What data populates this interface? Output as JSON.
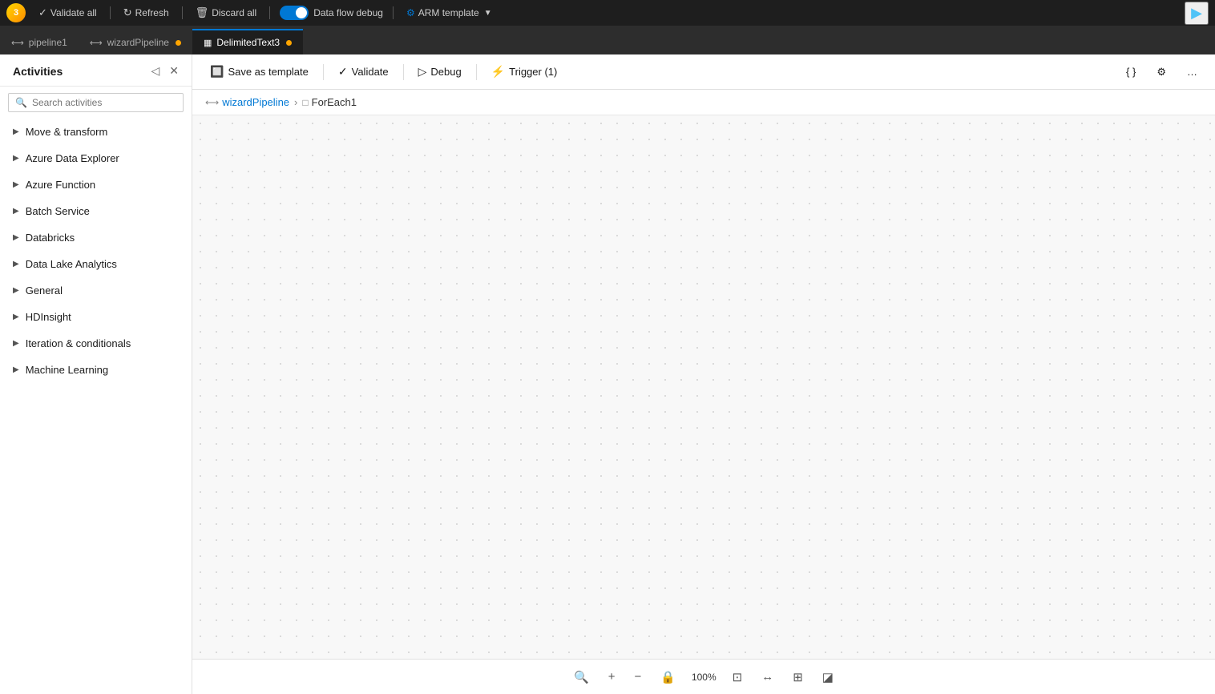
{
  "app": {
    "icon_label": "3",
    "validate_all_label": "Validate all",
    "refresh_label": "Refresh",
    "discard_all_label": "Discard all",
    "data_flow_debug_label": "Data flow debug",
    "arm_template_label": "ARM template",
    "run_icon": "▶"
  },
  "tabs": [
    {
      "id": "pipeline1",
      "label": "pipeline1",
      "icon": "🔀",
      "active": false,
      "dirty": false
    },
    {
      "id": "wizardPipeline",
      "label": "wizardPipeline",
      "icon": "🔀",
      "active": false,
      "dirty": true
    },
    {
      "id": "DelimitedText3",
      "label": "DelimitedText3",
      "icon": "📋",
      "active": true,
      "dirty": true
    }
  ],
  "sidebar": {
    "title": "Activities",
    "search_placeholder": "Search activities",
    "items": [
      {
        "id": "move-transform",
        "label": "Move & transform"
      },
      {
        "id": "azure-data-explorer",
        "label": "Azure Data Explorer"
      },
      {
        "id": "azure-function",
        "label": "Azure Function"
      },
      {
        "id": "batch-service",
        "label": "Batch Service"
      },
      {
        "id": "databricks",
        "label": "Databricks"
      },
      {
        "id": "data-lake-analytics",
        "label": "Data Lake Analytics"
      },
      {
        "id": "general",
        "label": "General"
      },
      {
        "id": "hdinsight",
        "label": "HDInsight"
      },
      {
        "id": "iteration-conditionals",
        "label": "Iteration & conditionals"
      },
      {
        "id": "machine-learning",
        "label": "Machine Learning"
      }
    ]
  },
  "canvas_toolbar": {
    "save_as_template_label": "Save as template",
    "validate_label": "Validate",
    "debug_label": "Debug",
    "trigger_label": "Trigger (1)"
  },
  "breadcrumb": {
    "pipeline_link": "wizardPipeline",
    "current": "ForEach1"
  },
  "footer": {
    "zoom_label": "100%"
  }
}
